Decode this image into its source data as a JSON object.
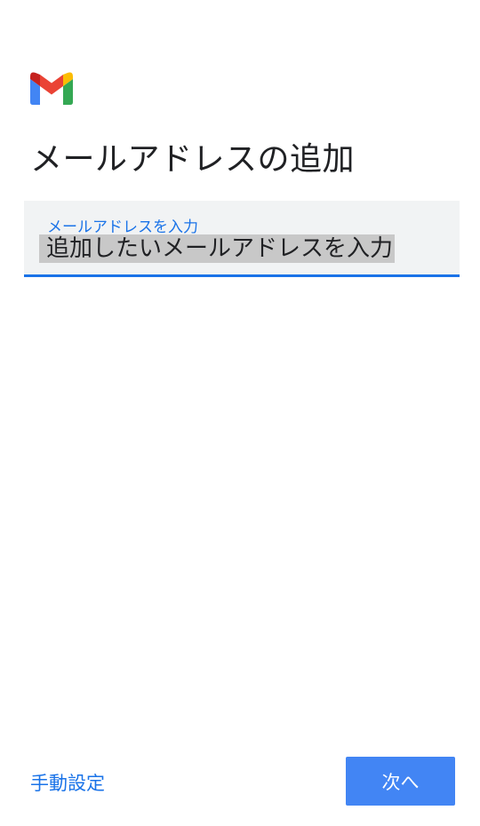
{
  "app": {
    "logo_icon": "gmail-logo-icon",
    "colors": {
      "blue": "#4285f4",
      "red": "#ea4335",
      "yellow": "#fbbc04",
      "green": "#34a853",
      "accent": "#1a73e8"
    }
  },
  "header": {
    "title": "メールアドレスの追加"
  },
  "email_field": {
    "label": "メールアドレスを入力",
    "value": "追加したいメールアドレスを入力"
  },
  "footer": {
    "manual_setup_label": "手動設定",
    "next_label": "次へ"
  }
}
